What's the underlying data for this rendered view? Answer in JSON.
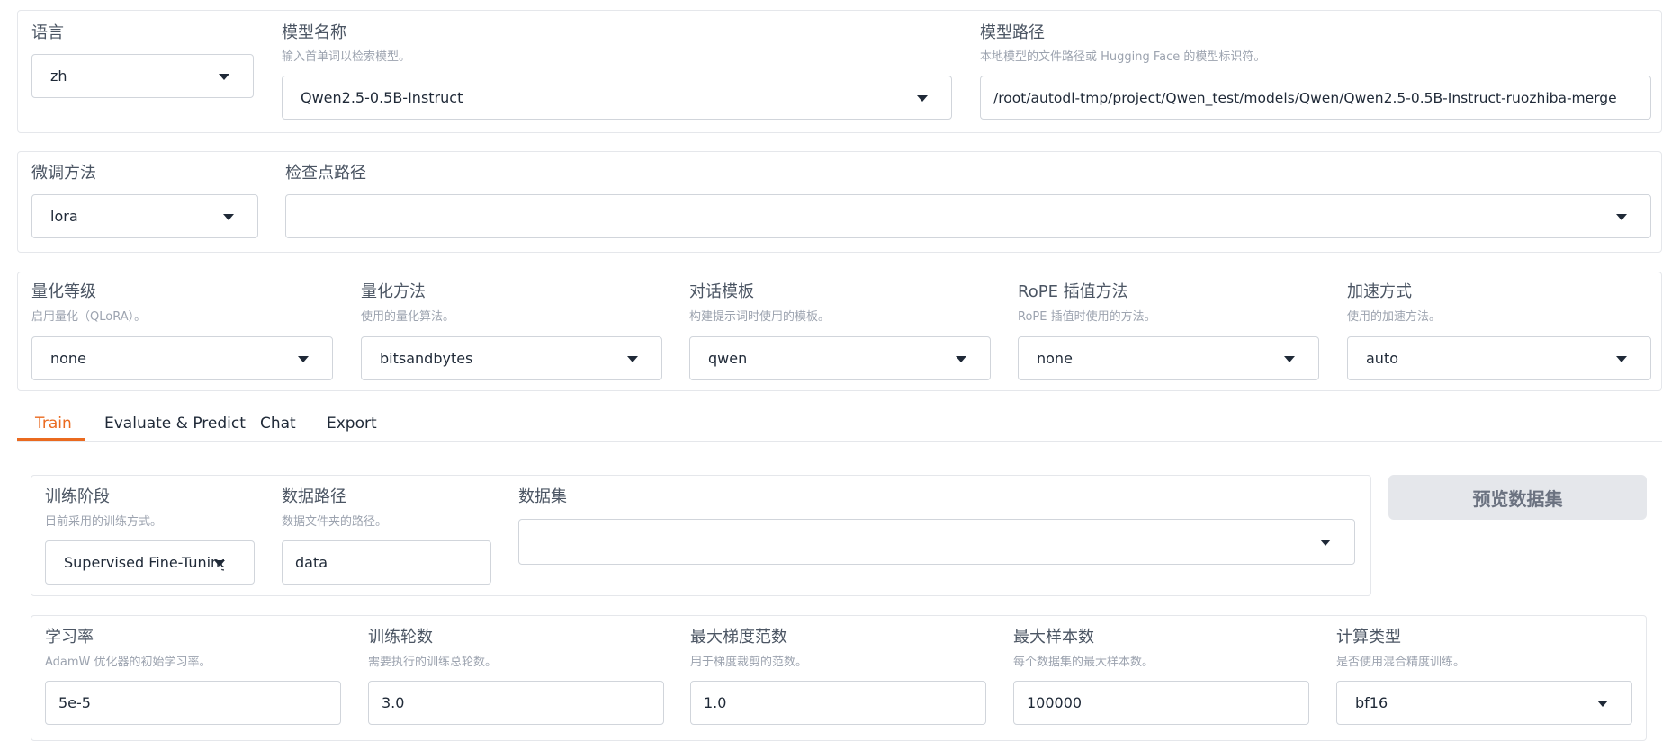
{
  "top": {
    "language": {
      "label": "语言",
      "value": "zh"
    },
    "model_name": {
      "label": "模型名称",
      "hint": "输入首单词以检索模型。",
      "value": "Qwen2.5-0.5B-Instruct"
    },
    "model_path": {
      "label": "模型路径",
      "hint": "本地模型的文件路径或 Hugging Face 的模型标识符。",
      "value": "/root/autodl-tmp/project/Qwen_test/models/Qwen/Qwen2.5-0.5B-Instruct-ruozhiba-merge"
    }
  },
  "finetune": {
    "method": {
      "label": "微调方法",
      "value": "lora"
    },
    "checkpoint": {
      "label": "检查点路径",
      "value": ""
    }
  },
  "advanced": {
    "quant_bit": {
      "label": "量化等级",
      "hint": "启用量化（QLoRA）。",
      "value": "none"
    },
    "quant_method": {
      "label": "量化方法",
      "hint": "使用的量化算法。",
      "value": "bitsandbytes"
    },
    "template": {
      "label": "对话模板",
      "hint": "构建提示词时使用的模板。",
      "value": "qwen"
    },
    "rope": {
      "label": "RoPE 插值方法",
      "hint": "RoPE 插值时使用的方法。",
      "value": "none"
    },
    "booster": {
      "label": "加速方式",
      "hint": "使用的加速方法。",
      "value": "auto"
    }
  },
  "tabs": [
    "Train",
    "Evaluate & Predict",
    "Chat",
    "Export"
  ],
  "accent_color": "#ea6a1f",
  "train": {
    "stage": {
      "label": "训练阶段",
      "hint": "目前采用的训练方式。",
      "value": "Supervised Fine-Tuning"
    },
    "dataset_dir": {
      "label": "数据路径",
      "hint": "数据文件夹的路径。",
      "value": "data"
    },
    "dataset": {
      "label": "数据集",
      "value": ""
    },
    "preview_button": "预览数据集"
  },
  "hyper": {
    "lr": {
      "label": "学习率",
      "hint": "AdamW 优化器的初始学习率。",
      "value": "5e-5"
    },
    "epochs": {
      "label": "训练轮数",
      "hint": "需要执行的训练总轮数。",
      "value": "3.0"
    },
    "max_grad_norm": {
      "label": "最大梯度范数",
      "hint": "用于梯度裁剪的范数。",
      "value": "1.0"
    },
    "max_samples": {
      "label": "最大样本数",
      "hint": "每个数据集的最大样本数。",
      "value": "100000"
    },
    "compute_type": {
      "label": "计算类型",
      "hint": "是否使用混合精度训练。",
      "value": "bf16"
    }
  }
}
